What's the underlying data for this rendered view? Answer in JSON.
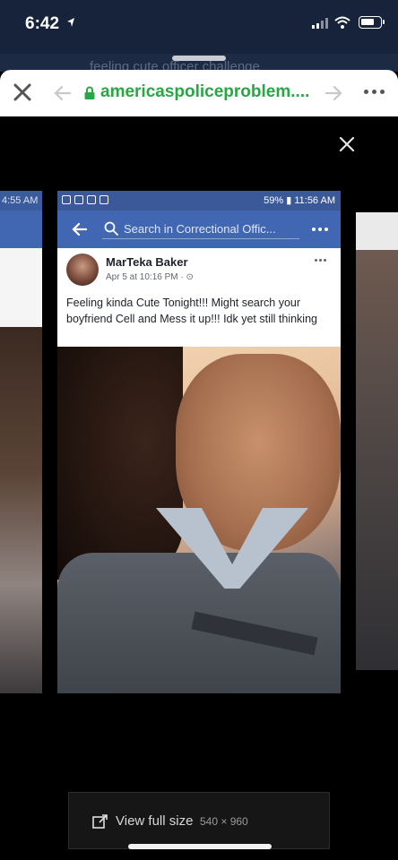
{
  "status_bar": {
    "time": "6:42",
    "location_icon": "location-arrow-icon",
    "signal_icon": "cellular-signal-icon",
    "wifi_icon": "wifi-icon",
    "battery_icon": "battery-icon",
    "battery_level": 0.75
  },
  "browser": {
    "background_hint": "feeling cute officer challenge",
    "url": "americaspoliceproblem....",
    "url_color": "#28a745",
    "close_icon": "close-icon",
    "back_icon": "back-arrow-icon",
    "lock_icon": "lock-icon",
    "forward_icon": "forward-arrow-icon",
    "more_icon": "more-dots-icon"
  },
  "viewer": {
    "close_icon": "close-icon",
    "left_card_time": "4:55 AM",
    "full_size_label": "View full size",
    "full_size_dims": "540 × 960",
    "external_icon": "external-link-icon"
  },
  "screenshot": {
    "status_right": "59% ▮ 11:56 AM",
    "search_placeholder": "Search in Correctional Offic...",
    "post": {
      "author": "MarTeka Baker",
      "meta": "Apr 5 at 10:16 PM · ⊙",
      "text": "Feeling kinda Cute Tonight!!! Might search your boyfriend Cell and Mess it up!!! Idk yet still thinking"
    },
    "colors": {
      "fb_blue": "#4267b2",
      "fb_dark_blue": "#3b5998"
    }
  }
}
